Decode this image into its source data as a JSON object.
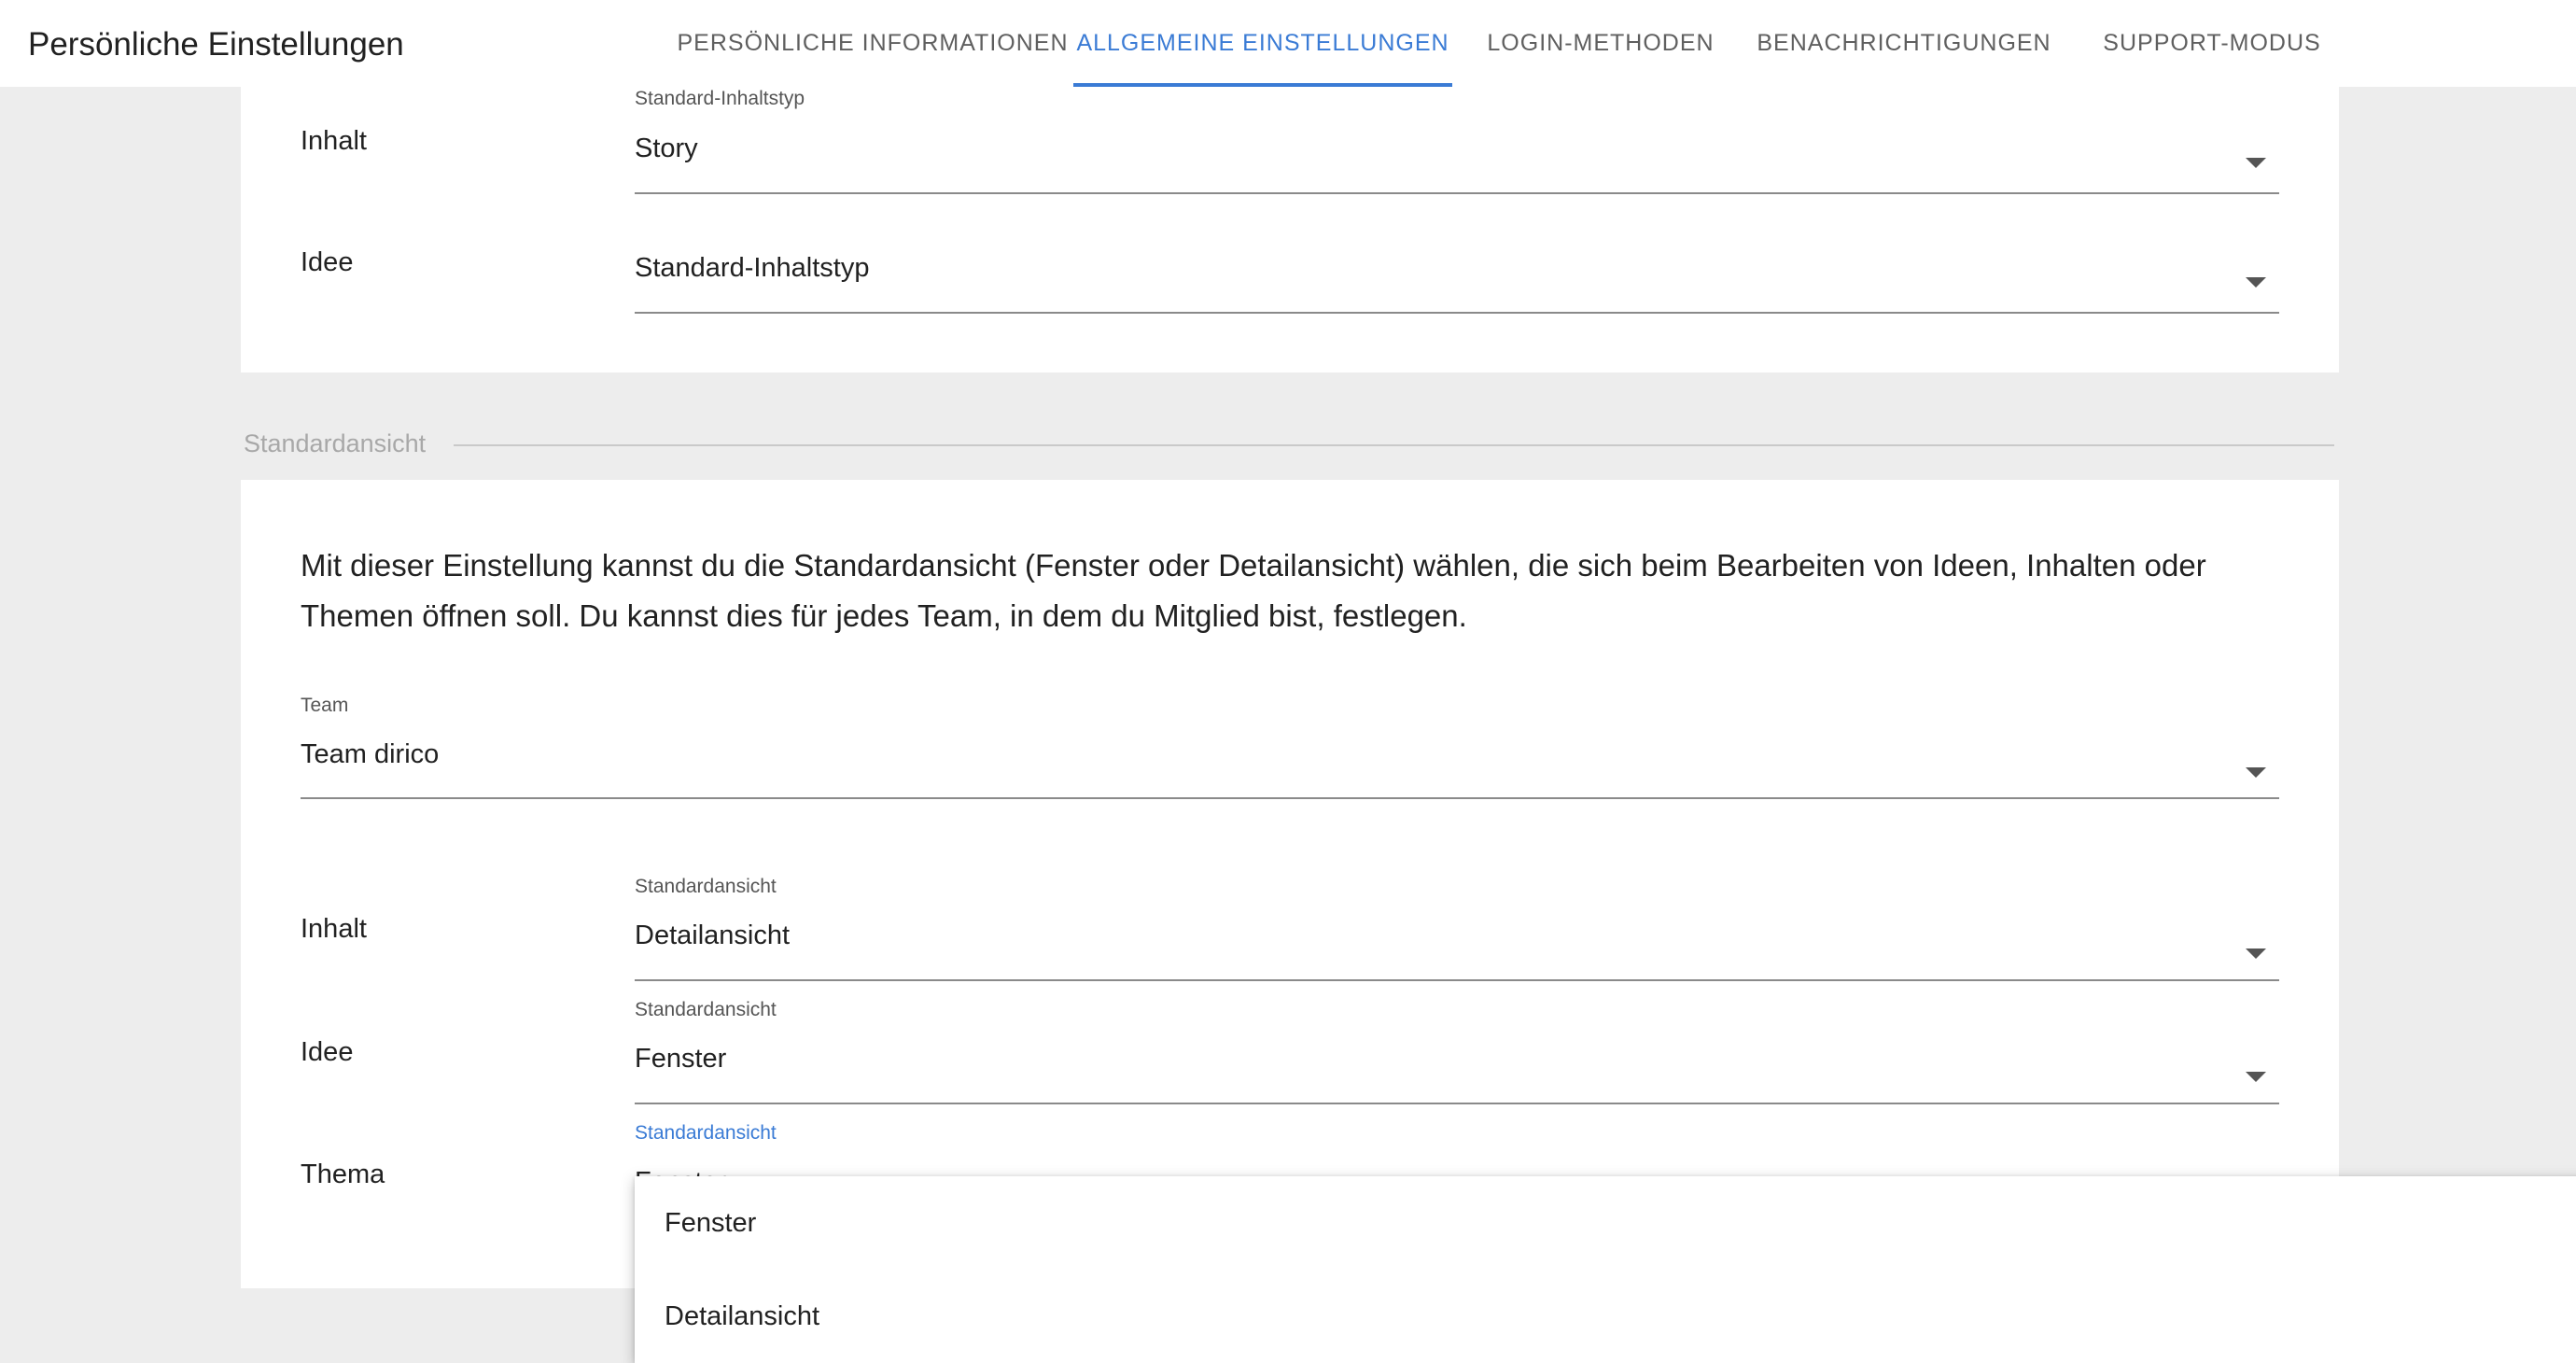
{
  "header": {
    "title": "Persönliche Einstellungen",
    "tabs": [
      {
        "label": "PERSÖNLICHE INFORMATIONEN",
        "active": false
      },
      {
        "label": "ALLGEMEINE EINSTELLUNGEN",
        "active": true
      },
      {
        "label": "LOGIN-METHODEN",
        "active": false
      },
      {
        "label": "BENACHRICHTIGUNGEN",
        "active": false
      },
      {
        "label": "SUPPORT-MODUS",
        "active": false
      }
    ]
  },
  "content_type_section": {
    "rows": [
      {
        "label": "Inhalt",
        "field_label": "Standard-Inhaltstyp",
        "value": "Story"
      },
      {
        "label": "Idee",
        "field_label": "",
        "value": "Standard-Inhaltstyp"
      }
    ]
  },
  "default_view_section": {
    "heading": "Standardansicht",
    "description": "Mit dieser Einstellung kannst du die Standardansicht (Fenster oder Detailansicht) wählen, die sich beim Bearbeiten von Ideen, Inhalten oder Themen öffnen soll. Du kannst dies für jedes Team, in dem du Mitglied bist, festlegen.",
    "team": {
      "field_label": "Team",
      "value": "Team dirico"
    },
    "rows": [
      {
        "label": "Inhalt",
        "field_label": "Standardansicht",
        "value": "Detailansicht"
      },
      {
        "label": "Idee",
        "field_label": "Standardansicht",
        "value": "Fenster"
      },
      {
        "label": "Thema",
        "field_label": "Standardansicht",
        "value": "Fenster"
      }
    ],
    "focused_label_color": "#3a7bd5"
  },
  "dropdown_menu": {
    "options": [
      "Fenster",
      "Detailansicht"
    ]
  },
  "colors": {
    "accent": "#3a7bd5",
    "background": "#ededed"
  }
}
